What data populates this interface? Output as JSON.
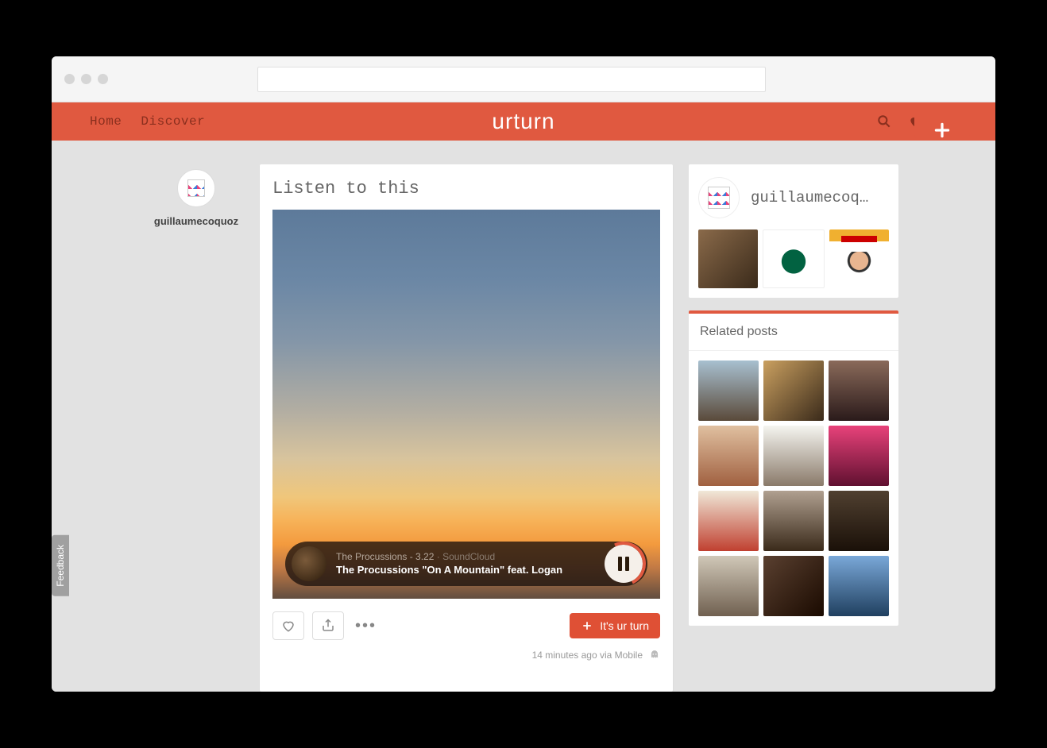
{
  "nav": {
    "home": "Home",
    "discover": "Discover"
  },
  "logo": "urturn",
  "author": {
    "name": "guillaumecoquoz"
  },
  "post": {
    "title": "Listen to this",
    "track_meta": "The Procussions - 3.22",
    "track_source": " · SoundCloud",
    "track_title": "The Procussions \"On A Mountain\" feat. Logan",
    "cta_label": "It's ur turn",
    "timestamp": "14 minutes ago via Mobile"
  },
  "profile": {
    "name": "guillaumecoq…"
  },
  "related": {
    "title": "Related posts"
  },
  "feedback": "Feedback"
}
